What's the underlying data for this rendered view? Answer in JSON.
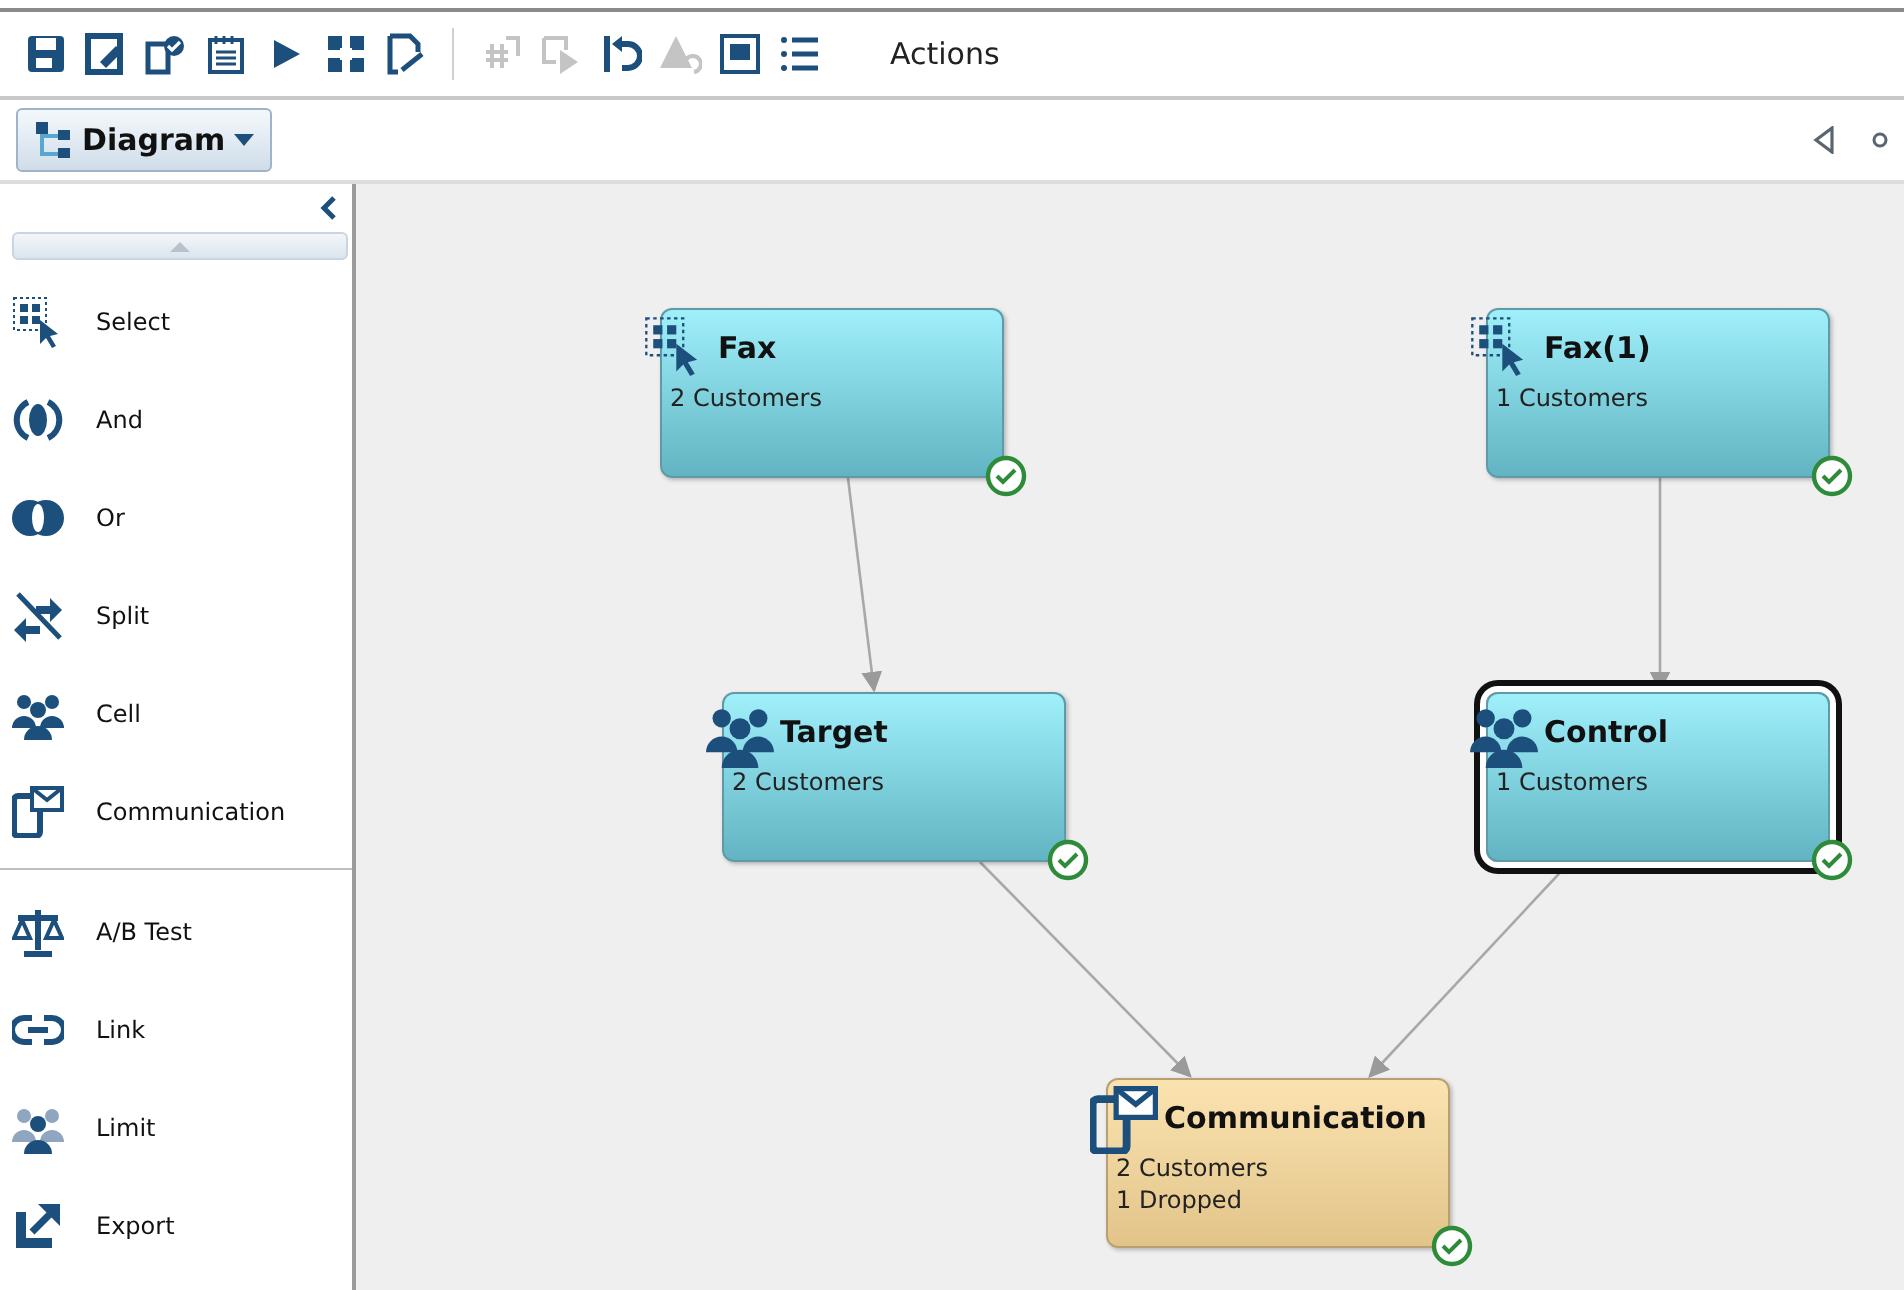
{
  "toolbar": {
    "buttons": [
      {
        "kind": "save",
        "disabled": false
      },
      {
        "kind": "edit",
        "disabled": false
      },
      {
        "kind": "validate",
        "disabled": false
      },
      {
        "kind": "notes",
        "disabled": false
      },
      {
        "kind": "run",
        "disabled": false
      },
      {
        "kind": "fit",
        "disabled": false
      },
      {
        "kind": "export",
        "disabled": false
      },
      {
        "kind": "count",
        "disabled": true
      },
      {
        "kind": "step",
        "disabled": true
      },
      {
        "kind": "undo",
        "disabled": false
      },
      {
        "kind": "warning",
        "disabled": true
      },
      {
        "kind": "frame",
        "disabled": false
      },
      {
        "kind": "list",
        "disabled": false
      }
    ],
    "menu": "Actions"
  },
  "view_bar": {
    "view_button": "Diagram"
  },
  "palette": {
    "groups": [
      [
        {
          "kind": "select",
          "label": "Select"
        },
        {
          "kind": "and",
          "label": "And"
        },
        {
          "kind": "or",
          "label": "Or"
        },
        {
          "kind": "split",
          "label": "Split"
        },
        {
          "kind": "cell",
          "label": "Cell"
        },
        {
          "kind": "communication",
          "label": "Communication"
        }
      ],
      [
        {
          "kind": "abtest",
          "label": "A/B Test"
        },
        {
          "kind": "link",
          "label": "Link"
        },
        {
          "kind": "limit",
          "label": "Limit"
        },
        {
          "kind": "export",
          "label": "Export"
        }
      ]
    ]
  },
  "diagram": {
    "nodes": [
      {
        "kind": "select",
        "title": "Fax",
        "lines": [
          "2 Customers"
        ],
        "selected": false,
        "complete": true
      },
      {
        "kind": "select",
        "title": "Fax(1)",
        "lines": [
          "1 Customers"
        ],
        "selected": false,
        "complete": true
      },
      {
        "kind": "cell",
        "title": "Target",
        "lines": [
          "2 Customers"
        ],
        "selected": false,
        "complete": true
      },
      {
        "kind": "cell",
        "title": "Control",
        "lines": [
          "1 Customers"
        ],
        "selected": true,
        "complete": true
      },
      {
        "kind": "communication",
        "title": "Communication",
        "lines": [
          "2 Customers",
          "1 Dropped"
        ],
        "selected": false,
        "complete": true
      }
    ]
  }
}
